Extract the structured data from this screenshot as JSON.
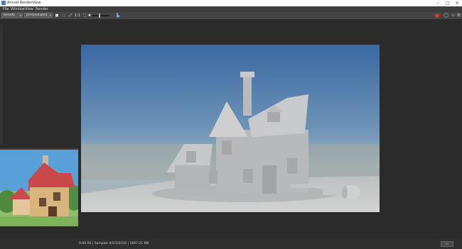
{
  "window": {
    "title": "Arnold RenderView",
    "minimize": "–",
    "maximize": "□",
    "close": "✕"
  },
  "menu": [
    "File",
    "Window",
    "View",
    "Render"
  ],
  "toolbar": {
    "aov_select": "Beauty",
    "camera_select": "perspShape1",
    "zoom": "1:1",
    "stop_icon": "stop-icon",
    "refresh_icon": "refresh-icon",
    "settings_icon": "gear-icon"
  },
  "status": {
    "text": "0:00:00 | Samples 4/2/2/2/2/0 | 1697.21 MB",
    "snapshot_button": "☐"
  },
  "colors": {
    "record": "#d83232",
    "sky_top": "#3f6ea7",
    "ground": "#c9cacb"
  }
}
